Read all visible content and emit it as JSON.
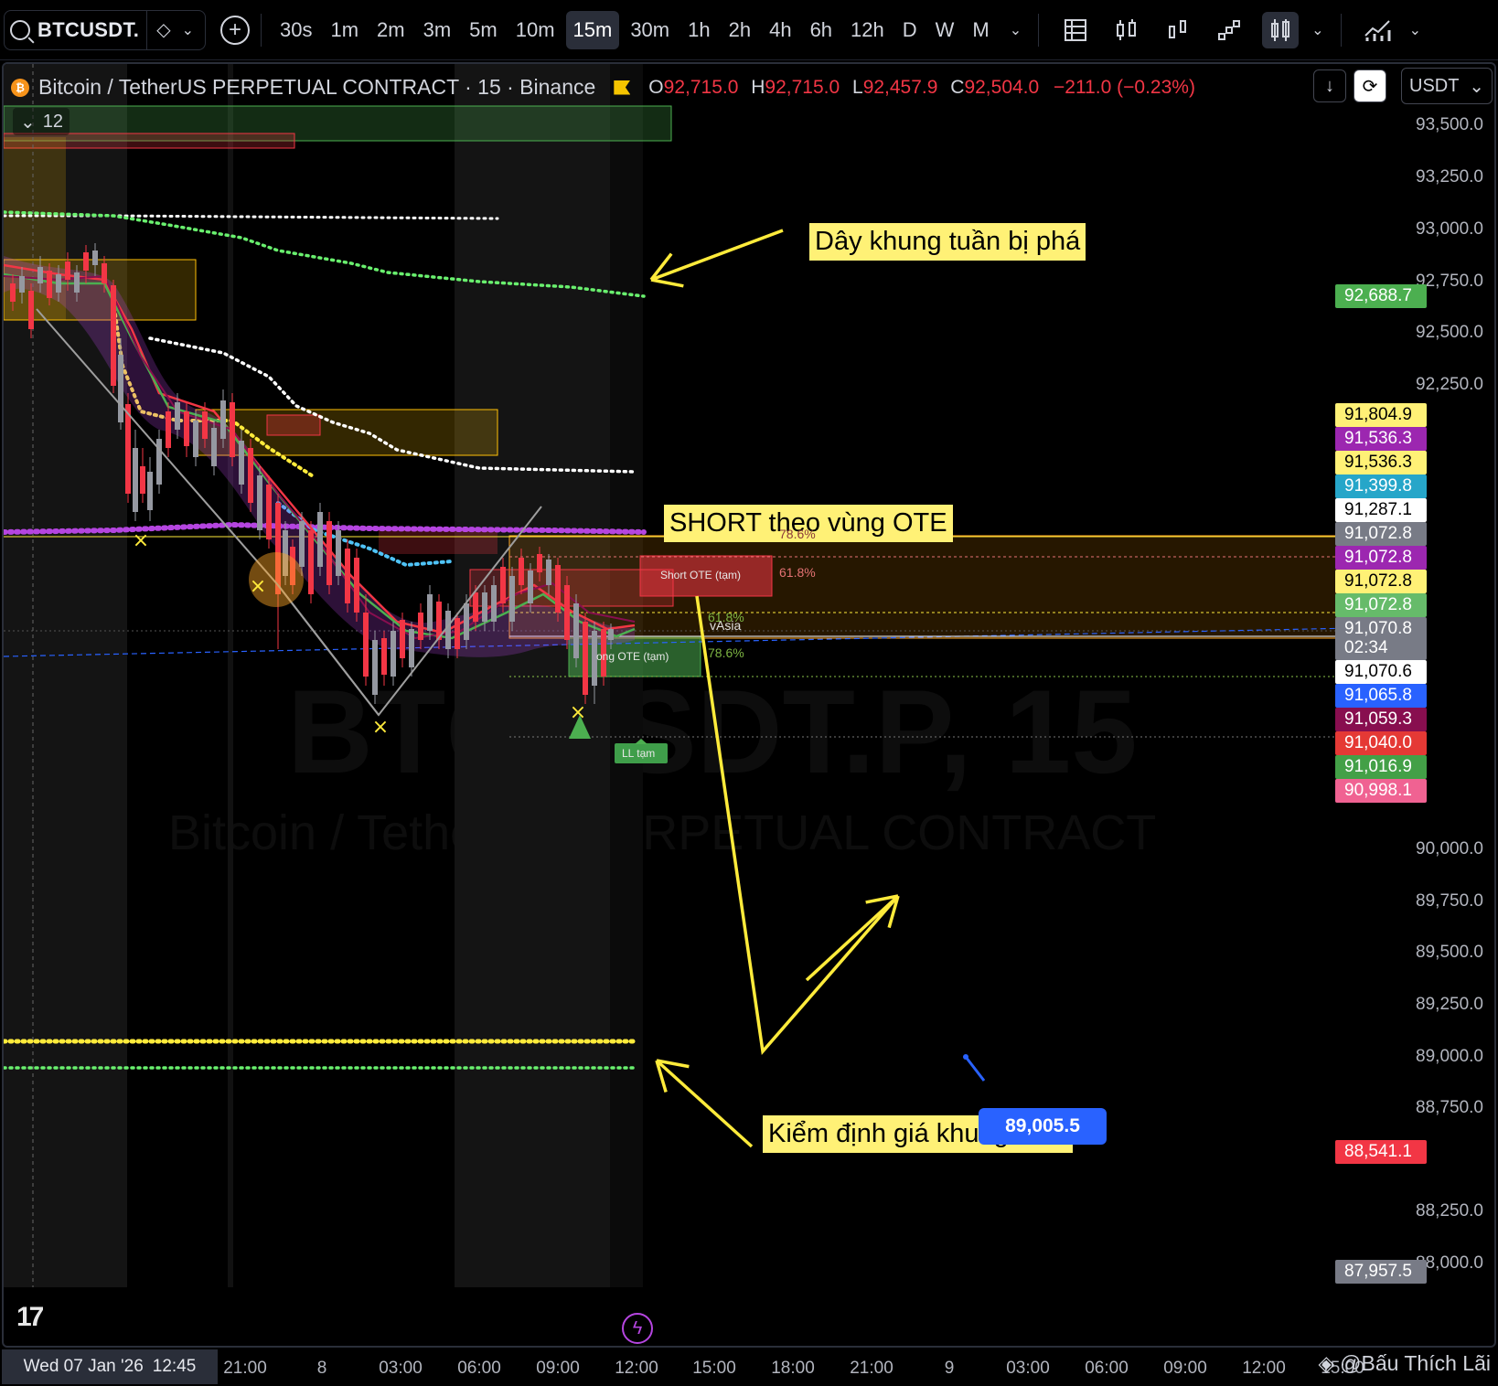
{
  "toolbar": {
    "symbol": "BTCUSDT.",
    "timeframes": [
      "30s",
      "1m",
      "2m",
      "3m",
      "5m",
      "10m",
      "15m",
      "30m",
      "1h",
      "2h",
      "4h",
      "6h",
      "12h",
      "D",
      "W",
      "M"
    ],
    "active_timeframe": "15m"
  },
  "legend": {
    "title": "Bitcoin / TetherUS PERPETUAL CONTRACT · 15 · Binance",
    "o_key": "O",
    "o_val": "92,715.0",
    "h_key": "H",
    "h_val": "92,715.0",
    "l_key": "L",
    "l_val": "92,457.9",
    "c_key": "C",
    "c_val": "92,504.0",
    "change": "−211.0 (−0.23%)",
    "indicator_count": "12",
    "currency": "USDT"
  },
  "price_axis": {
    "ticks": [
      "93,500.0",
      "93,250.0",
      "93,000.0",
      "92,750.0",
      "92,500.0",
      "92,250.0",
      "90,000.0",
      "89,750.0",
      "89,500.0",
      "89,250.0",
      "89,000.0",
      "88,750.0",
      "88,250.0",
      "88,000.0"
    ],
    "labels": [
      {
        "text": "92,688.7",
        "bg": "#4caf50",
        "fg": "#ffffff"
      },
      {
        "text": "91,804.9",
        "bg": "#fff176",
        "fg": "#000000"
      },
      {
        "text": "91,536.3",
        "bg": "#9c27b0",
        "fg": "#ffffff"
      },
      {
        "text": "91,536.3",
        "bg": "#fff176",
        "fg": "#000000"
      },
      {
        "text": "91,399.8",
        "bg": "#26a6c9",
        "fg": "#ffffff"
      },
      {
        "text": "91,287.1",
        "bg": "#ffffff",
        "fg": "#000000"
      },
      {
        "text": "91,072.8",
        "bg": "#787b86",
        "fg": "#ffffff"
      },
      {
        "text": "91,072.8",
        "bg": "#9c27b0",
        "fg": "#ffffff"
      },
      {
        "text": "91,072.8",
        "bg": "#fff176",
        "fg": "#000000"
      },
      {
        "text": "91,072.8",
        "bg": "#66bb6a",
        "fg": "#ffffff"
      },
      {
        "text": "91,070.8",
        "bg": "#787b86",
        "fg": "#ffffff"
      },
      {
        "text": "02:34",
        "bg": "#787b86",
        "fg": "#ffffff"
      },
      {
        "text": "91,070.6",
        "bg": "#ffffff",
        "fg": "#000000"
      },
      {
        "text": "91,065.8",
        "bg": "#2962ff",
        "fg": "#ffffff"
      },
      {
        "text": "91,059.3",
        "bg": "#880e4f",
        "fg": "#ffffff"
      },
      {
        "text": "91,040.0",
        "bg": "#e53935",
        "fg": "#ffffff"
      },
      {
        "text": "91,016.9",
        "bg": "#43a047",
        "fg": "#ffffff"
      },
      {
        "text": "90,998.1",
        "bg": "#f06292",
        "fg": "#ffffff"
      },
      {
        "text": "88,541.1",
        "bg": "#f23645",
        "fg": "#ffffff"
      },
      {
        "text": "87,957.5",
        "bg": "#787b86",
        "fg": "#ffffff"
      }
    ]
  },
  "time_axis": {
    "date_badge_date": "Wed 07 Jan '26",
    "date_badge_time": "12:45",
    "ticks": [
      "21:00",
      "8",
      "03:00",
      "06:00",
      "09:00",
      "12:00",
      "15:00",
      "18:00",
      "21:00",
      "9",
      "03:00",
      "06:00",
      "09:00",
      "12:00",
      "15:00"
    ]
  },
  "annotations": {
    "weekly_broken": "Dây khung tuần bị phá",
    "short_ote": "SHORT theo vùng OTE",
    "weekly_test": "Kiểm định giá khung tuần",
    "short_box": "Short OTE (tạm)",
    "long_box": "ong OTE (tạm)",
    "ll_tag": "LL tạm",
    "fib_786_top": "78.6%",
    "fib_618_top": "61.8%",
    "fib_618_mid": "61.8%",
    "vasia": "vAsia",
    "fib_786_bot": "78.6%",
    "target_price": "89,005.5"
  },
  "watermark": {
    "symbol": "BTCUSDT.P, 15",
    "description": "Bitcoin / TetherUS PERPETUAL CONTRACT"
  },
  "credit": "@Bấu Thích Lãi",
  "colors": {
    "up": "#9598a1",
    "down": "#f23645",
    "weekly_green": "#69f06e",
    "weekly_yellow": "#ffeb3b",
    "purple": "#b545e0",
    "cyan": "#4fc3f7"
  }
}
